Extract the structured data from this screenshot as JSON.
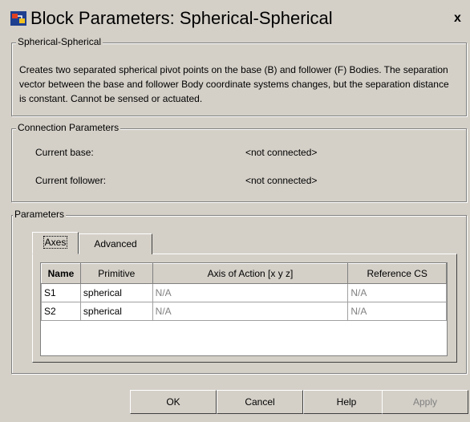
{
  "window": {
    "title": "Block Parameters: Spherical-Spherical",
    "close_label": "x"
  },
  "description_group": {
    "legend": "Spherical-Spherical",
    "text": "Creates two separated spherical pivot points on the base (B) and follower (F) Bodies. The separation vector between the base and follower Body coordinate systems changes, but the separation distance is constant. Cannot be sensed or actuated."
  },
  "connection_group": {
    "legend": "Connection Parameters",
    "current_base_label": "Current base:",
    "current_base_value": "<not connected>",
    "current_follower_label": "Current follower:",
    "current_follower_value": "<not connected>"
  },
  "parameters_group": {
    "legend": "Parameters",
    "tabs": [
      {
        "label": "Axes",
        "active": true
      },
      {
        "label": "Advanced",
        "active": false
      }
    ],
    "table": {
      "headers": [
        "Name",
        "Primitive",
        "Axis of Action [x y z]",
        "Reference CS"
      ],
      "rows": [
        [
          "S1",
          "spherical",
          "N/A",
          "N/A"
        ],
        [
          "S2",
          "spherical",
          "N/A",
          "N/A"
        ]
      ]
    }
  },
  "buttons": {
    "ok": "OK",
    "cancel": "Cancel",
    "help": "Help",
    "apply": "Apply"
  }
}
